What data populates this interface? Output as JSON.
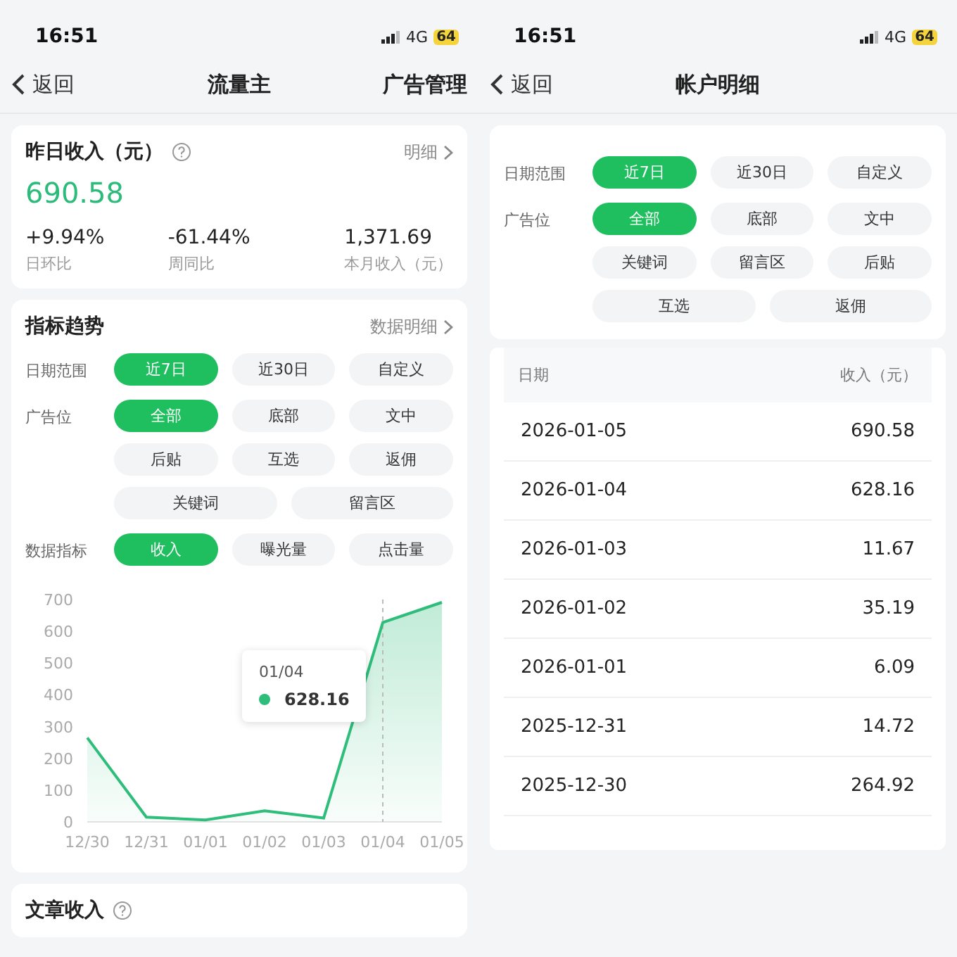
{
  "left": {
    "status": {
      "time": "16:51",
      "network": "4G",
      "battery": "64"
    },
    "nav": {
      "back": "返回",
      "title": "流量主",
      "action": "广告管理"
    },
    "summary": {
      "title": "昨日收入（元）",
      "link": "明细",
      "amount": "690.58",
      "stats": [
        {
          "value": "+9.94%",
          "label": "日环比"
        },
        {
          "value": "-61.44%",
          "label": "周同比"
        },
        {
          "value": "1,371.69",
          "label": "本月收入（元）"
        }
      ]
    },
    "trend": {
      "title": "指标趋势",
      "link": "数据明细",
      "filters": [
        {
          "label": "日期范围",
          "lines": [
            [
              {
                "label": "近7日",
                "selected": true
              },
              {
                "label": "近30日",
                "selected": false
              },
              {
                "label": "自定义",
                "selected": false
              }
            ]
          ]
        },
        {
          "label": "广告位",
          "lines": [
            [
              {
                "label": "全部",
                "selected": true
              },
              {
                "label": "底部",
                "selected": false
              },
              {
                "label": "文中",
                "selected": false
              }
            ],
            [
              {
                "label": "后贴",
                "selected": false
              },
              {
                "label": "互选",
                "selected": false
              },
              {
                "label": "返佣",
                "selected": false
              }
            ],
            [
              {
                "label": "关键词",
                "selected": false
              },
              {
                "label": "留言区",
                "selected": false
              }
            ]
          ]
        },
        {
          "label": "数据指标",
          "lines": [
            [
              {
                "label": "收入",
                "selected": true
              },
              {
                "label": "曝光量",
                "selected": false
              },
              {
                "label": "点击量",
                "selected": false
              }
            ]
          ]
        }
      ],
      "chart_data": {
        "type": "area",
        "categories": [
          "12/30",
          "12/31",
          "01/01",
          "01/02",
          "01/03",
          "01/04",
          "01/05"
        ],
        "series": [
          {
            "color": "#2ebd7a",
            "values": [
              265,
              15,
              6,
              35,
              12,
              628,
              691
            ]
          }
        ],
        "ylim": [
          0,
          700
        ],
        "yticks": [
          0,
          100,
          200,
          300,
          400,
          500,
          600,
          700
        ]
      },
      "tooltip": {
        "date": "01/04",
        "value": "628.16"
      }
    },
    "article": {
      "title": "文章收入"
    }
  },
  "right": {
    "status": {
      "time": "16:51",
      "network": "4G",
      "battery": "64"
    },
    "nav": {
      "back": "返回",
      "title": "帐户明细"
    },
    "filters": [
      {
        "label": "日期范围",
        "lines": [
          [
            {
              "label": "近7日",
              "selected": true
            },
            {
              "label": "近30日",
              "selected": false
            },
            {
              "label": "自定义",
              "selected": false
            }
          ]
        ]
      },
      {
        "label": "广告位",
        "lines": [
          [
            {
              "label": "全部",
              "selected": true
            },
            {
              "label": "底部",
              "selected": false
            },
            {
              "label": "文中",
              "selected": false
            }
          ],
          [
            {
              "label": "关键词",
              "selected": false
            },
            {
              "label": "留言区",
              "selected": false
            },
            {
              "label": "后贴",
              "selected": false
            }
          ],
          [
            {
              "label": "互选",
              "selected": false
            },
            {
              "label": "返佣",
              "selected": false
            }
          ]
        ]
      }
    ],
    "table": {
      "columns": [
        "日期",
        "收入（元）"
      ],
      "rows": [
        [
          "2026-01-05",
          "690.58"
        ],
        [
          "2026-01-04",
          "628.16"
        ],
        [
          "2026-01-03",
          "11.67"
        ],
        [
          "2026-01-02",
          "35.19"
        ],
        [
          "2026-01-01",
          "6.09"
        ],
        [
          "2025-12-31",
          "14.72"
        ],
        [
          "2025-12-30",
          "264.92"
        ]
      ]
    }
  }
}
